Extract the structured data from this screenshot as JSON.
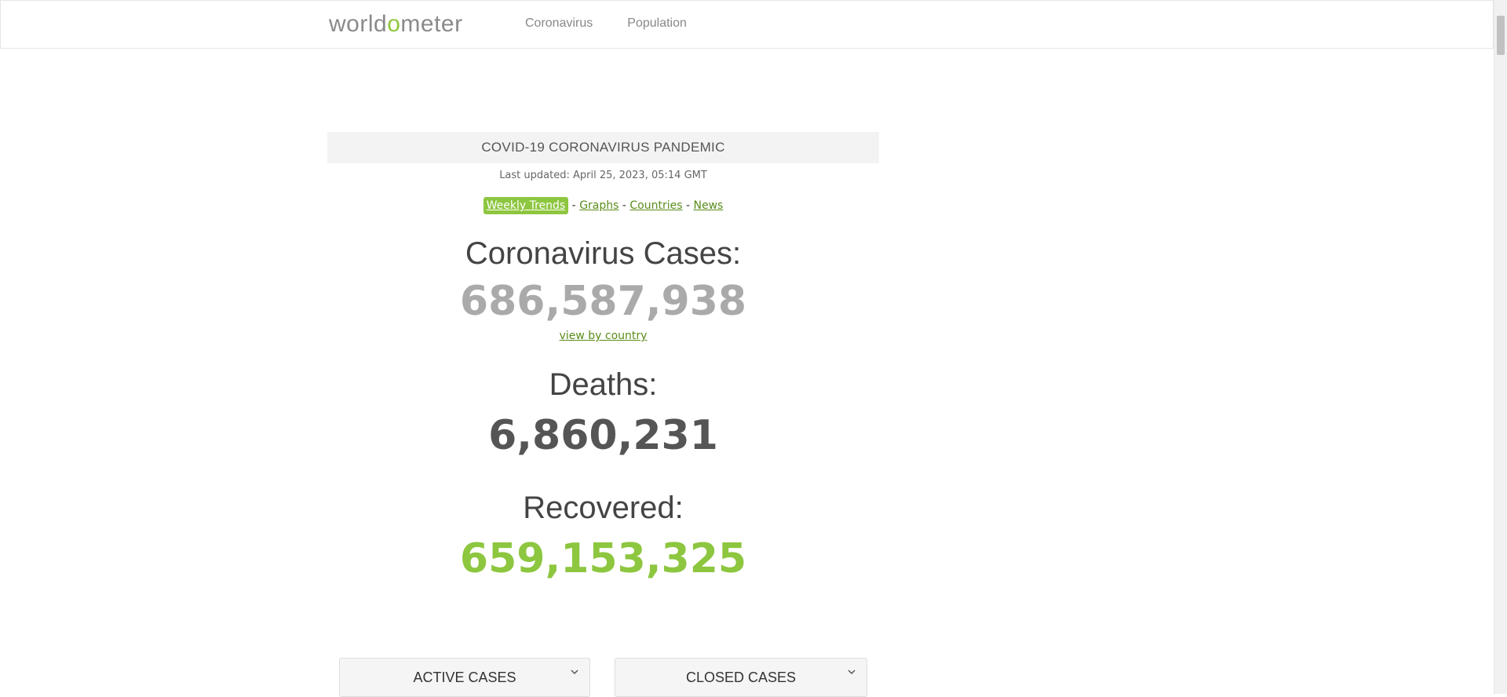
{
  "navbar": {
    "logo_part1": "world",
    "logo_accent": "o",
    "logo_part2": "meter",
    "links": [
      "Coronavirus",
      "Population"
    ]
  },
  "header": {
    "title": "COVID-19 CORONAVIRUS PANDEMIC",
    "last_updated": "Last updated: April 25, 2023, 05:14 GMT"
  },
  "links": {
    "weekly_trends": "Weekly Trends",
    "sep": "-",
    "graphs": "Graphs",
    "countries": "Countries",
    "news": "News"
  },
  "stats": {
    "cases_label": "Coronavirus Cases:",
    "cases_value": "686,587,938",
    "view_by_country": "view by country",
    "deaths_label": "Deaths:",
    "deaths_value": "6,860,231",
    "recovered_label": "Recovered:",
    "recovered_value": "659,153,325"
  },
  "panels": {
    "active": "ACTIVE CASES",
    "closed": "CLOSED CASES"
  },
  "colors": {
    "accent": "#8dc63f",
    "link": "#5a8c1a",
    "cases": "#aaaaaa",
    "deaths": "#555555"
  },
  "icons": {
    "panel_toggle": "chevron-down-icon"
  }
}
